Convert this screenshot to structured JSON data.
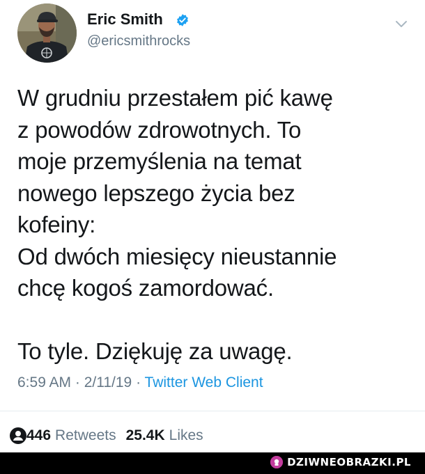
{
  "tweet": {
    "author": {
      "display_name": "Eric Smith",
      "handle": "@ericsmithrocks",
      "verified": true,
      "avatar": "avatar-photo-man-in-black-tshirt"
    },
    "menu_icon": "chevron-down-icon",
    "text_lines": [
      "W grudniu przestałem pić kawę",
      "z powodów zdrowotnych. To",
      "moje przemyślenia na temat",
      "nowego lepszego życia bez",
      "kofeiny:",
      "Od dwóch miesięcy nieustannie",
      "chcę kogoś zamordować.",
      "",
      "To tyle. Dziękuję za uwagę."
    ],
    "time": "6:59 AM",
    "date": "2/11/19",
    "client": "Twitter Web Client",
    "meta_separator": " · ",
    "retweets_count": "446",
    "retweets_label": "Retweets",
    "likes_count": "25.4K",
    "likes_label": "Likes"
  },
  "watermark": {
    "text": "DZIWNEOBRAZKI.PL"
  },
  "colors": {
    "text": "#14171a",
    "secondary": "#657786",
    "link": "#1b95e0",
    "verified_badge": "#1da1f2",
    "divider": "#e6ecf0",
    "watermark_bar": "#000000",
    "watermark_logo": "#c23c9c"
  }
}
